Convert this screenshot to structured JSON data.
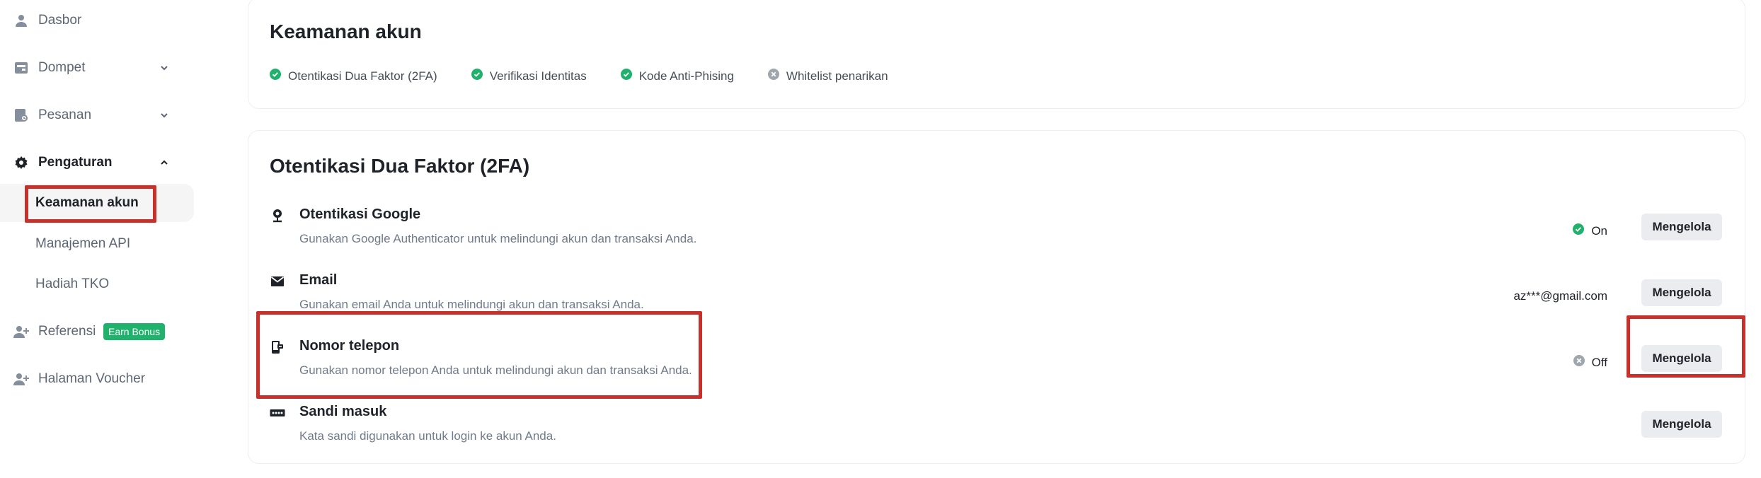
{
  "sidebar": {
    "items": [
      {
        "label": "Dasbor",
        "icon": "user-icon"
      },
      {
        "label": "Dompet",
        "icon": "wallet-icon"
      },
      {
        "label": "Pesanan",
        "icon": "orders-icon"
      },
      {
        "label": "Pengaturan",
        "icon": "gear-icon"
      },
      {
        "label": "Referensi",
        "icon": "add-user-icon",
        "badge": "Earn Bonus"
      },
      {
        "label": "Halaman Voucher",
        "icon": "add-user-icon"
      }
    ],
    "sub_items": [
      {
        "label": "Keamanan akun"
      },
      {
        "label": "Manajemen API"
      },
      {
        "label": "Hadiah TKO"
      }
    ]
  },
  "security_card": {
    "title": "Keamanan akun",
    "statuses": [
      {
        "label": "Otentikasi Dua Faktor (2FA)",
        "state": "enabled"
      },
      {
        "label": "Verifikasi Identitas",
        "state": "enabled"
      },
      {
        "label": "Kode Anti-Phising",
        "state": "enabled"
      },
      {
        "label": "Whitelist penarikan",
        "state": "disabled"
      }
    ]
  },
  "twofa_card": {
    "title": "Otentikasi Dua Faktor (2FA)",
    "methods": [
      {
        "title": "Otentikasi Google",
        "description": "Gunakan Google Authenticator untuk melindungi akun dan transaksi Anda.",
        "status": "On",
        "button": "Mengelola",
        "icon": "authenticator-icon"
      },
      {
        "title": "Email",
        "description": "Gunakan email Anda untuk melindungi akun dan transaksi Anda.",
        "status": "az***@gmail.com",
        "button": "Mengelola",
        "icon": "mail-icon"
      },
      {
        "title": "Nomor telepon",
        "description": "Gunakan nomor telepon Anda untuk melindungi akun dan transaksi Anda.",
        "status": "Off",
        "button": "Mengelola",
        "icon": "phone-icon"
      },
      {
        "title": "Sandi masuk",
        "description": "Kata sandi digunakan untuk login ke akun Anda.",
        "button": "Mengelola",
        "icon": "password-icon"
      }
    ]
  },
  "colors": {
    "success": "#20b26c",
    "muted": "#a0a6ae",
    "annotation": "#c8302b",
    "button_bg": "#eaecef"
  }
}
